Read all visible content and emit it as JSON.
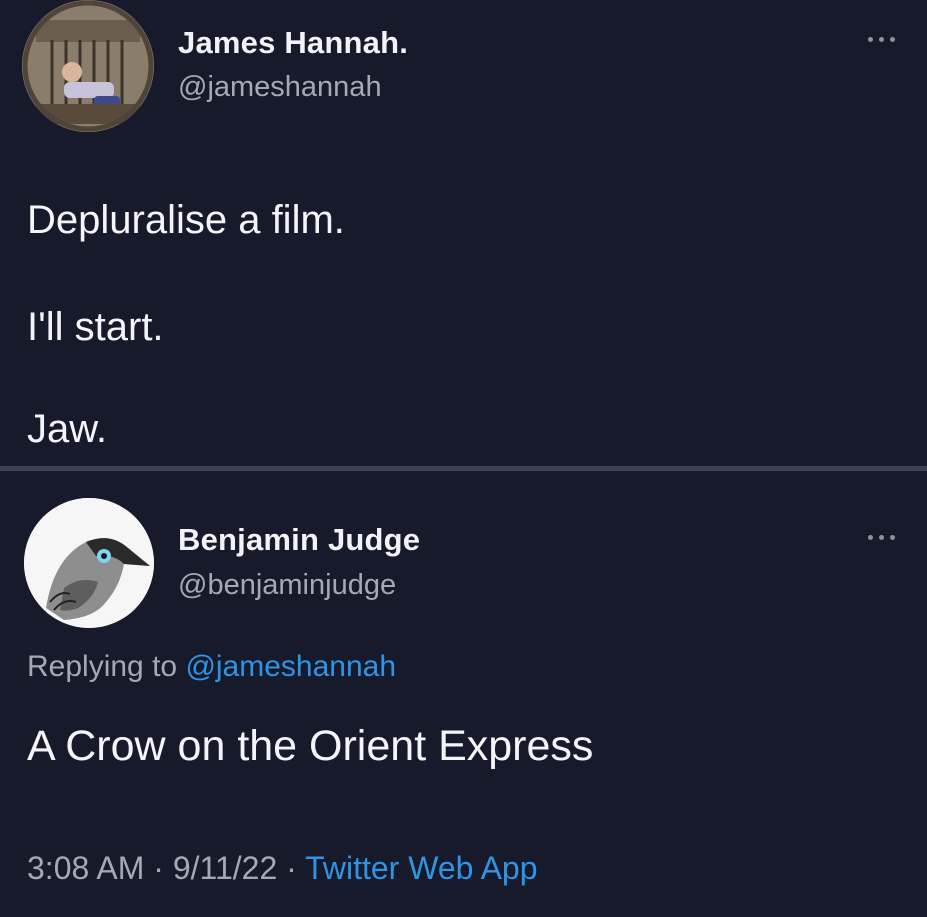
{
  "original_tweet": {
    "display_name": "James Hannah.",
    "handle": "@jameshannah",
    "avatar_icon": "profile-photo-icon",
    "more_icon": "more-options-icon",
    "lines": [
      "Depluralise a film.",
      "I'll start.",
      "Jaw."
    ]
  },
  "reply_tweet": {
    "display_name": "Benjamin Judge",
    "handle": "@benjaminjudge",
    "avatar_icon": "crow-avatar-icon",
    "more_icon": "more-options-icon",
    "replying_prefix": "Replying to",
    "replying_to": "@jameshannah",
    "text": "A Crow on the Orient Express",
    "time": "3:08 AM",
    "separator_1": "·",
    "date": "9/11/22",
    "separator_2": "·",
    "source": "Twitter Web App"
  },
  "colors": {
    "background": "#161a2b",
    "link": "#2f93e6",
    "secondary_text": "#a4a9b6",
    "primary_text": "#f4f5f8",
    "divider": "#3a4152"
  }
}
